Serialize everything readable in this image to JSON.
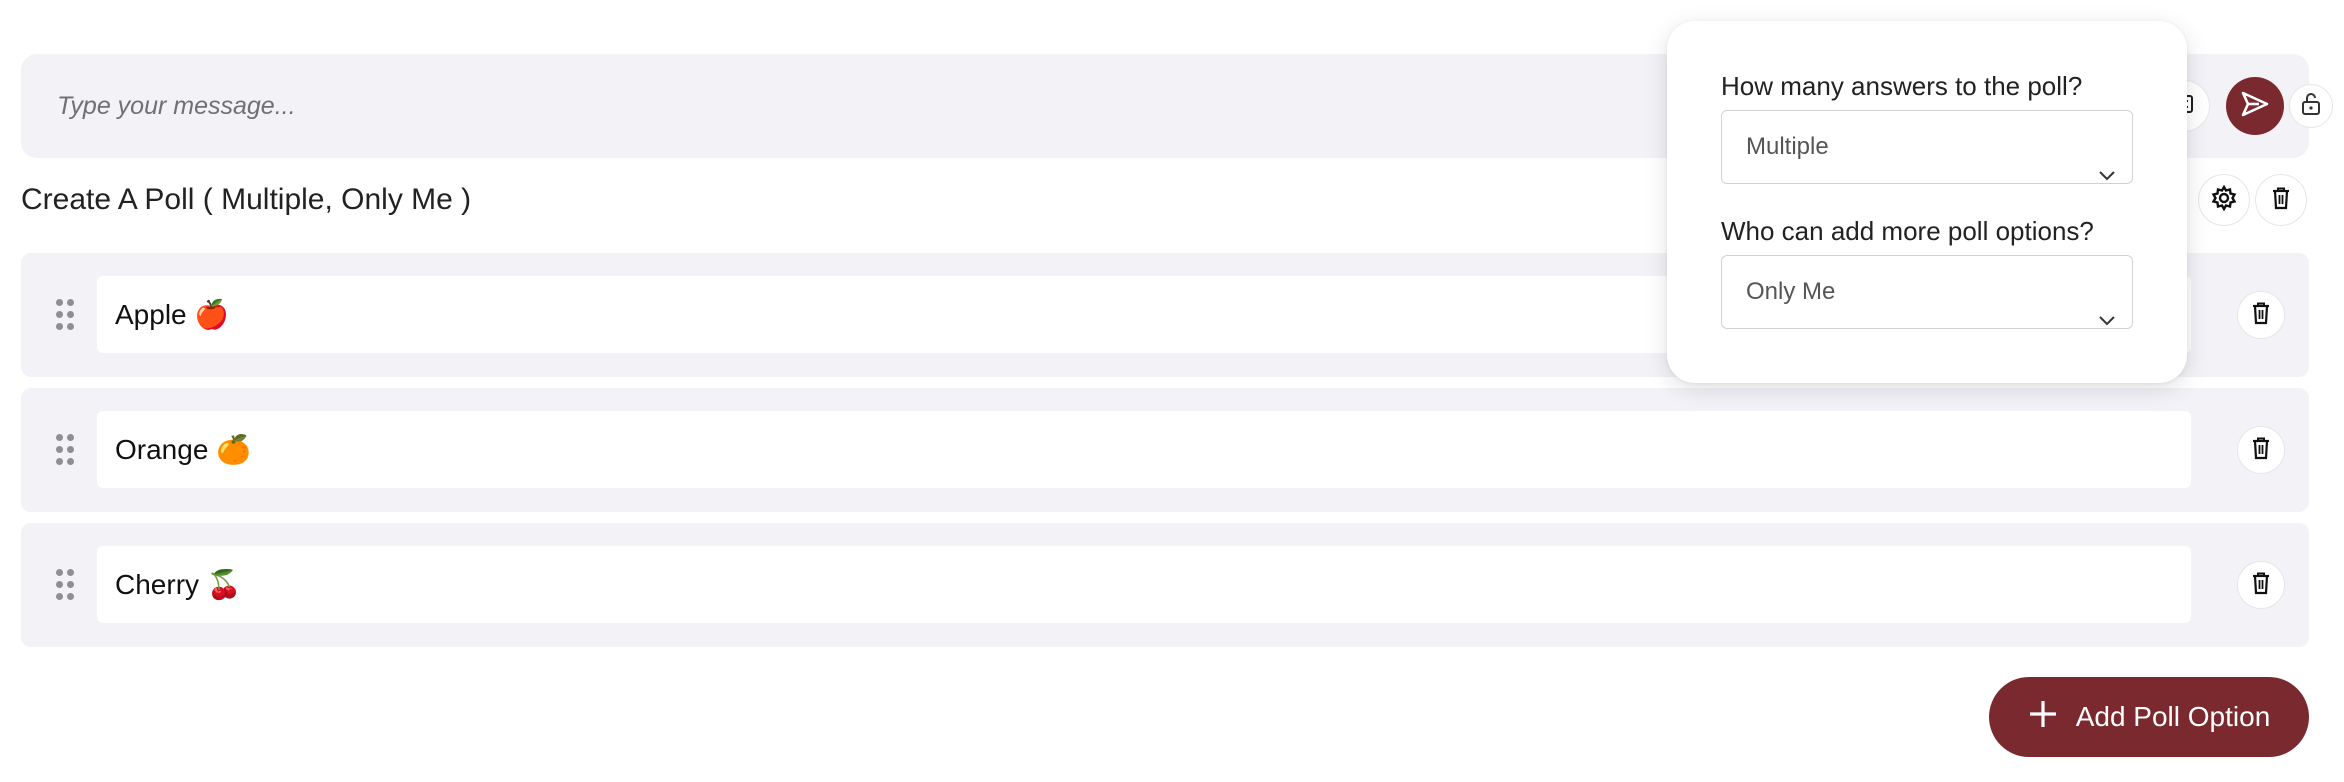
{
  "composer": {
    "placeholder": "Type your message..."
  },
  "poll": {
    "title": "Create A Poll ( Multiple, Only Me )",
    "options": [
      {
        "label": "Apple 🍎"
      },
      {
        "label": "Orange 🍊"
      },
      {
        "label": "Cherry 🍒"
      }
    ],
    "add_label": "Add Poll Option"
  },
  "settings_popover": {
    "answers_label": "How many answers to the poll?",
    "answers_value": "Multiple",
    "add_options_label": "Who can add more poll options?",
    "add_options_value": "Only Me"
  },
  "icons": {
    "send": "send-icon",
    "lock": "lock-icon",
    "settings": "gear-icon",
    "delete": "trash-icon",
    "drag": "drag-handle-icon",
    "add": "plus-icon",
    "dropdown": "chevron-down-icon"
  },
  "colors": {
    "accent": "#7a2a2e",
    "panel": "#f2f2f7"
  }
}
